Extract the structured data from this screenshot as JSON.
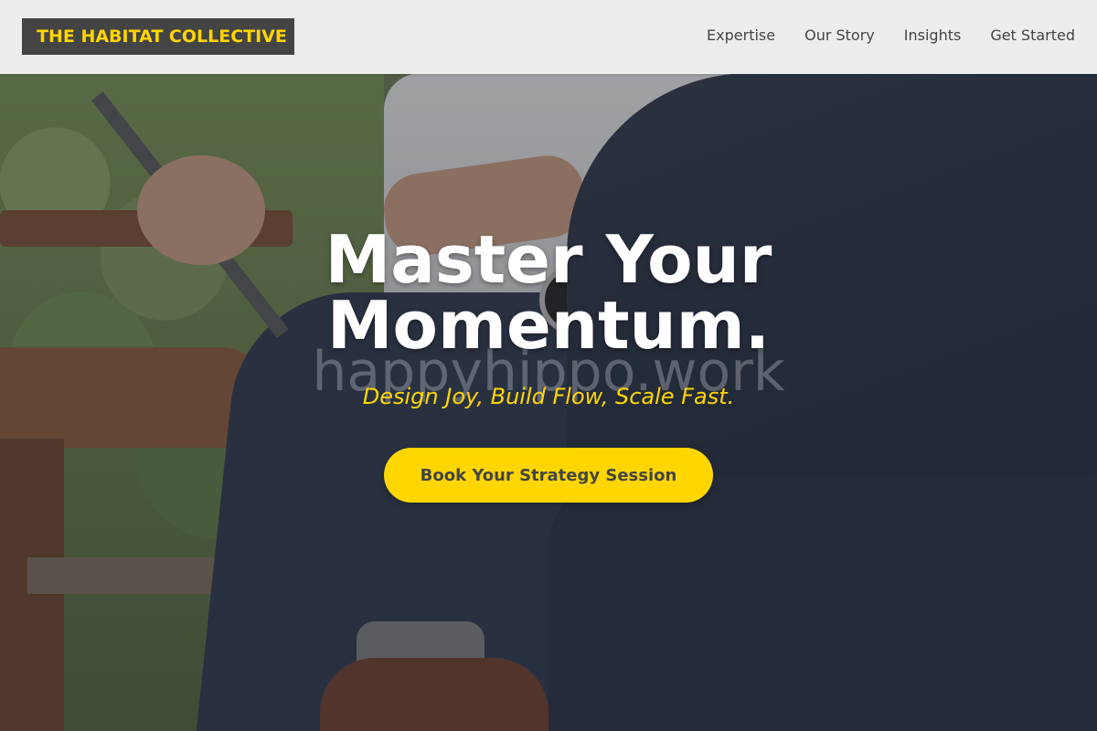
{
  "header": {
    "logo_text": "THE HABITAT COLLECTIVE",
    "nav": [
      {
        "label": "Expertise"
      },
      {
        "label": "Our Story"
      },
      {
        "label": "Insights"
      },
      {
        "label": "Get Started"
      }
    ]
  },
  "hero": {
    "title_line1": "Master Your",
    "title_line2": "Momentum.",
    "subtitle": "Design Joy, Build Flow, Scale Fast.",
    "watermark": "happyhippo.work",
    "cta_label": "Book Your Strategy Session"
  },
  "colors": {
    "accent": "#ffd600",
    "logo_background": "#444444",
    "header_background": "#f2f2f2",
    "text_dark": "#444444",
    "title_text": "#ffffff"
  }
}
